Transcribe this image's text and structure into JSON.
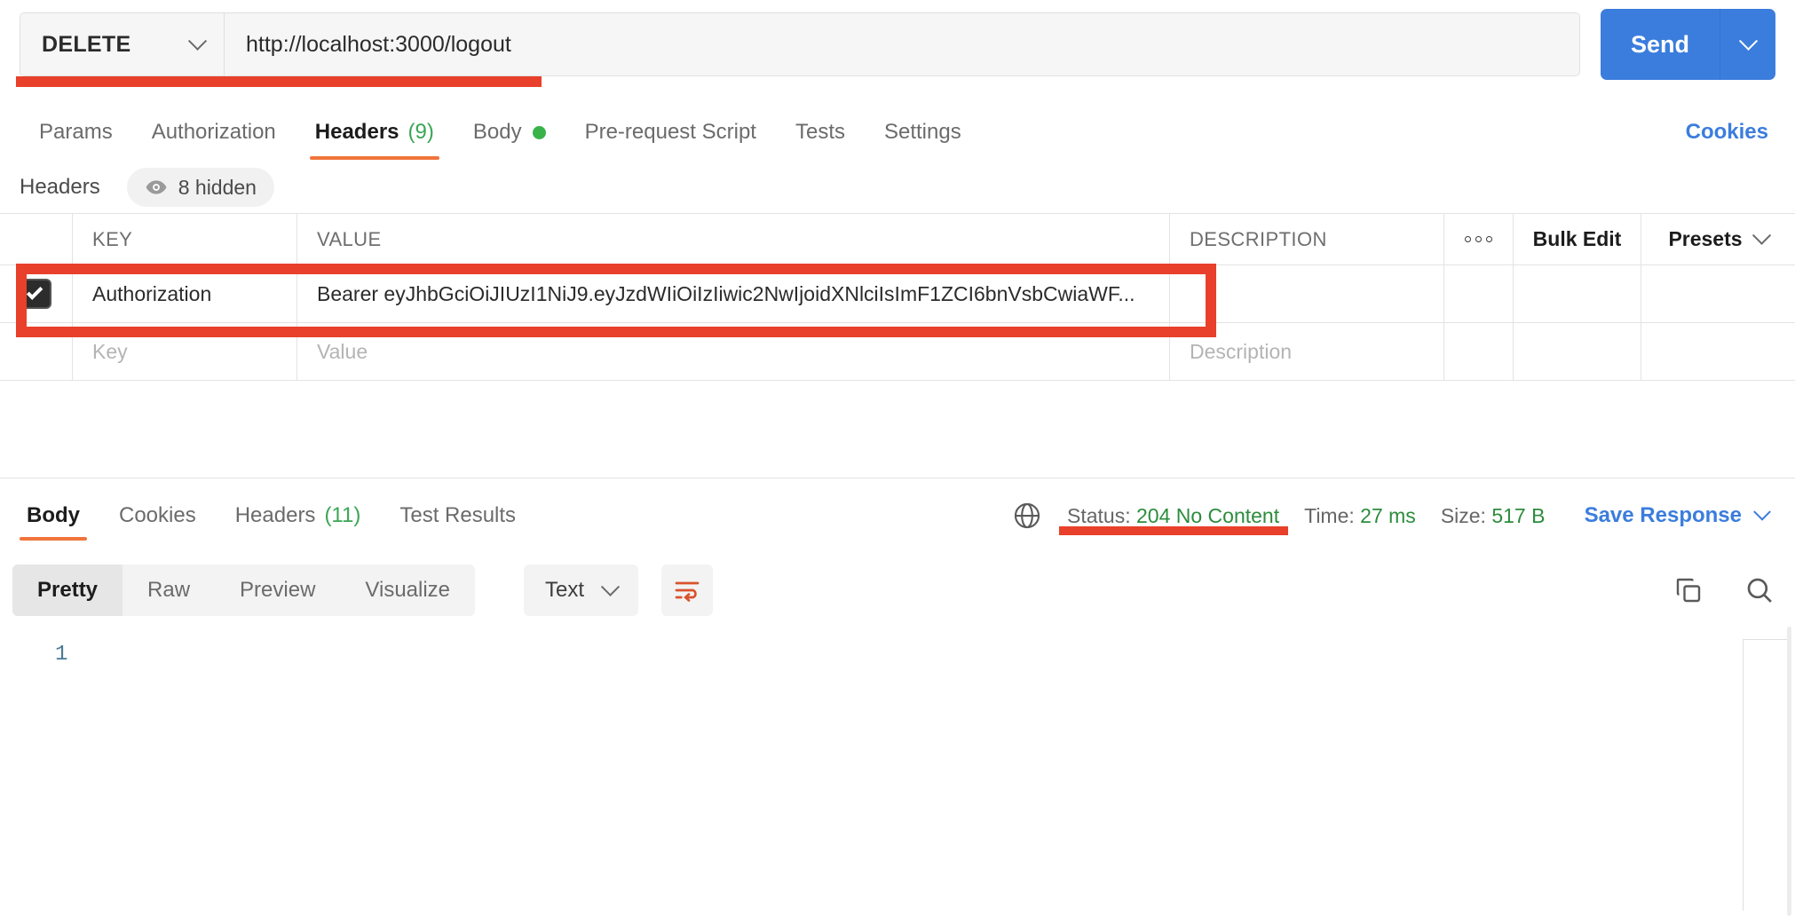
{
  "request": {
    "method": "DELETE",
    "url": "http://localhost:3000/logout",
    "send_label": "Send",
    "tabs": [
      {
        "label": "Params",
        "count": null,
        "active": false,
        "dot": false
      },
      {
        "label": "Authorization",
        "count": null,
        "active": false,
        "dot": false
      },
      {
        "label": "Headers",
        "count": "(9)",
        "active": true,
        "dot": false
      },
      {
        "label": "Body",
        "count": null,
        "active": false,
        "dot": true
      },
      {
        "label": "Pre-request Script",
        "count": null,
        "active": false,
        "dot": false
      },
      {
        "label": "Tests",
        "count": null,
        "active": false,
        "dot": false
      },
      {
        "label": "Settings",
        "count": null,
        "active": false,
        "dot": false
      }
    ],
    "cookies_link": "Cookies"
  },
  "headers_section": {
    "title": "Headers",
    "hidden_badge": "8 hidden",
    "columns": {
      "key": "KEY",
      "value": "VALUE",
      "description": "DESCRIPTION"
    },
    "bulk_edit": "Bulk Edit",
    "presets": "Presets",
    "rows": [
      {
        "checked": true,
        "key": "Authorization",
        "value": "Bearer eyJhbGciOiJIUzI1NiJ9.eyJzdWIiOiIzIiwic2NwIjoidXNlciIsImF1ZCI6bnVsbCwiaWF...",
        "description": ""
      }
    ],
    "placeholders": {
      "key": "Key",
      "value": "Value",
      "description": "Description"
    }
  },
  "response": {
    "tabs": [
      {
        "label": "Body",
        "count": null,
        "active": true
      },
      {
        "label": "Cookies",
        "count": null,
        "active": false
      },
      {
        "label": "Headers",
        "count": "(11)",
        "active": false
      },
      {
        "label": "Test Results",
        "count": null,
        "active": false
      }
    ],
    "status_label": "Status:",
    "status_value": "204 No Content",
    "time_label": "Time:",
    "time_value": "27 ms",
    "size_label": "Size:",
    "size_value": "517 B",
    "save_response": "Save Response",
    "view_modes": [
      {
        "label": "Pretty",
        "active": true
      },
      {
        "label": "Raw",
        "active": false
      },
      {
        "label": "Preview",
        "active": false
      },
      {
        "label": "Visualize",
        "active": false
      }
    ],
    "content_type": "Text",
    "line_numbers": [
      "1"
    ],
    "body_lines": [
      ""
    ]
  },
  "colors": {
    "accent_orange": "#f0743b",
    "annotation_red": "#e8402a",
    "link_blue": "#3b7ddd",
    "status_green": "#2c8c3c"
  }
}
